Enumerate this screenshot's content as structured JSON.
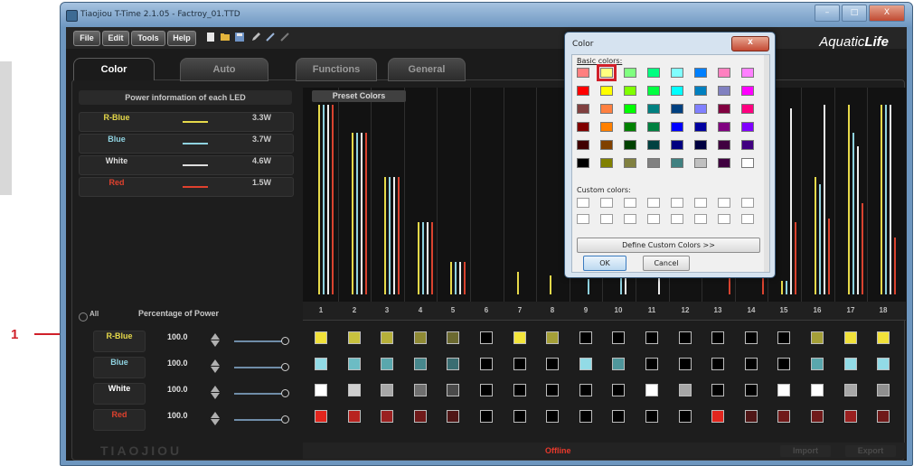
{
  "annotation": {
    "number": "1"
  },
  "window": {
    "title": "Tiaojiou T-Time 2.1.05 - Factroy_01.TTD",
    "minimize": "–",
    "maximize": "□",
    "close": "X"
  },
  "menu": [
    {
      "label": "File",
      "x": 8,
      "w": 28
    },
    {
      "label": "Edit",
      "x": 40,
      "w": 28
    },
    {
      "label": "Tools",
      "x": 72,
      "w": 36
    },
    {
      "label": "Help",
      "x": 112,
      "w": 30
    }
  ],
  "logo": {
    "text_a": "Aquatic",
    "text_b": "Life"
  },
  "tabs": [
    {
      "label": "Color",
      "active": true
    },
    {
      "label": "Auto",
      "active": false
    },
    {
      "label": "Functions",
      "active": false
    },
    {
      "label": "General",
      "active": false
    }
  ],
  "power_panel": {
    "title": "Power information of each LED",
    "rows": [
      {
        "name": "R-Blue",
        "color": "#e6d94a",
        "watt": "3.3W"
      },
      {
        "name": "Blue",
        "color": "#8fd2e0",
        "watt": "3.7W"
      },
      {
        "name": "White",
        "color": "#dddddd",
        "watt": "4.6W"
      },
      {
        "name": "Red",
        "color": "#e0412e",
        "watt": "1.5W"
      }
    ]
  },
  "preset_label": "Preset Colors",
  "percentage": {
    "all_label": "All",
    "title": "Percentage of Power",
    "rows": [
      {
        "name": "R-Blue",
        "color": "#e6d94a",
        "value": "100.0",
        "percent": 100
      },
      {
        "name": "Blue",
        "color": "#8fd2e0",
        "value": "100.0",
        "percent": 100
      },
      {
        "name": "White",
        "color": "#ffffff",
        "value": "100.0",
        "percent": 100
      },
      {
        "name": "Red",
        "color": "#e0412e",
        "value": "100.0",
        "percent": 100
      }
    ]
  },
  "chart_data": {
    "type": "bar",
    "categories": [
      "1",
      "2",
      "3",
      "4",
      "5",
      "6",
      "7",
      "8",
      "9",
      "10",
      "11",
      "12",
      "13",
      "14",
      "15",
      "16",
      "17",
      "18"
    ],
    "series": [
      {
        "color": "#e6d94a",
        "values": [
          1.0,
          0.85,
          0.62,
          0.38,
          0.17,
          0,
          0.12,
          0.1,
          0,
          0,
          0,
          0,
          0,
          0,
          0.07,
          0.62,
          1.0,
          1.0
        ]
      },
      {
        "color": "#8fd2e0",
        "values": [
          1.0,
          0.85,
          0.62,
          0.38,
          0.17,
          0,
          0,
          0,
          0.08,
          0.1,
          0,
          0,
          0,
          0,
          0.07,
          0.58,
          0.85,
          1.0
        ]
      },
      {
        "color": "#eeeeee",
        "values": [
          1.0,
          0.85,
          0.62,
          0.38,
          0.17,
          0,
          0,
          0,
          0,
          0.12,
          0.12,
          0,
          0,
          0,
          0.98,
          1.0,
          0.78,
          1.0
        ]
      },
      {
        "color": "#d9432f",
        "values": [
          1.0,
          0.85,
          0.62,
          0.38,
          0.17,
          0,
          0,
          0,
          0,
          0,
          0,
          0,
          0.5,
          0.5,
          0.38,
          0.4,
          0.48,
          0.3
        ]
      }
    ]
  },
  "swatches": [
    [
      "#f1e13a",
      "#c8c23e",
      "#b6b03a",
      "#8f8a35",
      "#6b6930",
      "#000000",
      "#f3e53b",
      "#a49f38",
      "#000000",
      "#000000",
      "#000000",
      "#000000",
      "#000000",
      "#000000",
      "#000000",
      "#a49f38",
      "#f1e13a",
      "#f1e13a"
    ],
    [
      "#92dbe6",
      "#6cbcc4",
      "#5aa7ad",
      "#47878c",
      "#3a6d72",
      "#000000",
      "#000000",
      "#000000",
      "#92dbe6",
      "#4f969b",
      "#000000",
      "#000000",
      "#000000",
      "#000000",
      "#000000",
      "#5aa7ad",
      "#92dbe6",
      "#92dbe6"
    ],
    [
      "#ffffff",
      "#cfcfcf",
      "#a7a7a7",
      "#6f6f6f",
      "#4a4a4a",
      "#000000",
      "#000000",
      "#000000",
      "#000000",
      "#000000",
      "#ffffff",
      "#a7a7a7",
      "#000000",
      "#000000",
      "#ffffff",
      "#ffffff",
      "#a7a7a7",
      "#8f8f8f"
    ],
    [
      "#e2261e",
      "#b82320",
      "#9a2020",
      "#701a1a",
      "#501616",
      "#000000",
      "#000000",
      "#000000",
      "#000000",
      "#000000",
      "#000000",
      "#000000",
      "#e2261e",
      "#501616",
      "#701a1a",
      "#701a1a",
      "#9a2020",
      "#701a1a"
    ]
  ],
  "bottom": {
    "brand": "TIAOJIOU",
    "status": "Offline",
    "import": "Import",
    "export": "Export"
  },
  "color_dialog": {
    "title": "Color",
    "close": "x",
    "basic_label": "Basic colors:",
    "custom_label": "Custom colors:",
    "define_button": "Define Custom Colors >>",
    "ok": "OK",
    "cancel": "Cancel",
    "selected_index": 1,
    "basic_colors": [
      "#ff8080",
      "#ffff80",
      "#80ff80",
      "#00ff80",
      "#80ffff",
      "#0080ff",
      "#ff80c0",
      "#ff80ff",
      "#ff0000",
      "#ffff00",
      "#80ff00",
      "#00ff40",
      "#00ffff",
      "#0080c0",
      "#8080c0",
      "#ff00ff",
      "#804040",
      "#ff8040",
      "#00ff00",
      "#008080",
      "#004080",
      "#8080ff",
      "#800040",
      "#ff0080",
      "#800000",
      "#ff8000",
      "#008000",
      "#008040",
      "#0000ff",
      "#0000a0",
      "#800080",
      "#8000ff",
      "#400000",
      "#804000",
      "#004000",
      "#004040",
      "#000080",
      "#000040",
      "#400040",
      "#400080",
      "#000000",
      "#808000",
      "#808040",
      "#808080",
      "#408080",
      "#c0c0c0",
      "#400040",
      "#ffffff"
    ]
  }
}
